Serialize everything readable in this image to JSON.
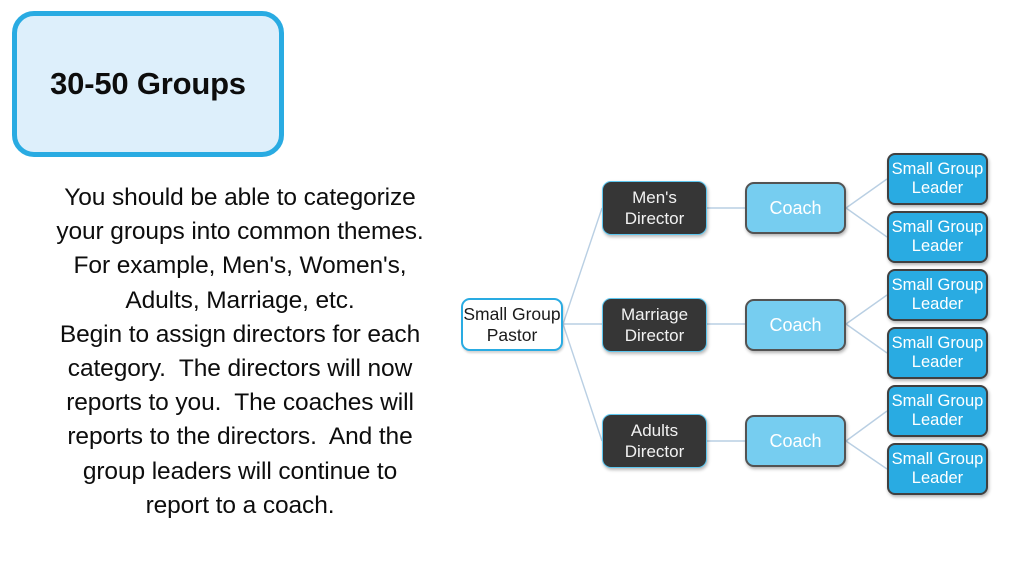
{
  "slide": {
    "background_color": "#ffffff",
    "title": {
      "label": "30-50 Groups",
      "fill_color": "#ddeffb",
      "border_color": "#29abe2",
      "text_color": "#0d0d0d"
    },
    "body": {
      "lines": [
        "You should be able to categorize",
        "your groups into common themes.",
        "For example, Men's, Women's,",
        "Adults, Marriage, etc.",
        "Begin to assign directors for each",
        "category.  The directors will now",
        "reports to you.  The coaches will",
        "reports to the directors.  And the",
        "group leaders will continue to",
        "report to a coach."
      ]
    }
  },
  "org_chart": {
    "colors": {
      "pastor_border": "#29abe2",
      "pastor_fill": "#ffffff",
      "director_fill": "#363636",
      "coach_fill": "#76cdf0",
      "leader_fill": "#29abe2",
      "connector": "#b9cfe3"
    },
    "root": {
      "label": "Small Group\nPastor",
      "line1": "Small Group",
      "line2": "Pastor"
    },
    "branches": [
      {
        "director": {
          "line1": "Men's",
          "line2": "Director"
        },
        "coach": {
          "label": "Coach"
        },
        "leaders": [
          {
            "line1": "Small Group",
            "line2": "Leader"
          },
          {
            "line1": "Small Group",
            "line2": "Leader"
          }
        ]
      },
      {
        "director": {
          "line1": "Marriage",
          "line2": "Director"
        },
        "coach": {
          "label": "Coach"
        },
        "leaders": [
          {
            "line1": "Small Group",
            "line2": "Leader"
          },
          {
            "line1": "Small Group",
            "line2": "Leader"
          }
        ]
      },
      {
        "director": {
          "line1": "Adults",
          "line2": "Director"
        },
        "coach": {
          "label": "Coach"
        },
        "leaders": [
          {
            "line1": "Small Group",
            "line2": "Leader"
          },
          {
            "line1": "Small Group",
            "line2": "Leader"
          }
        ]
      }
    ]
  }
}
